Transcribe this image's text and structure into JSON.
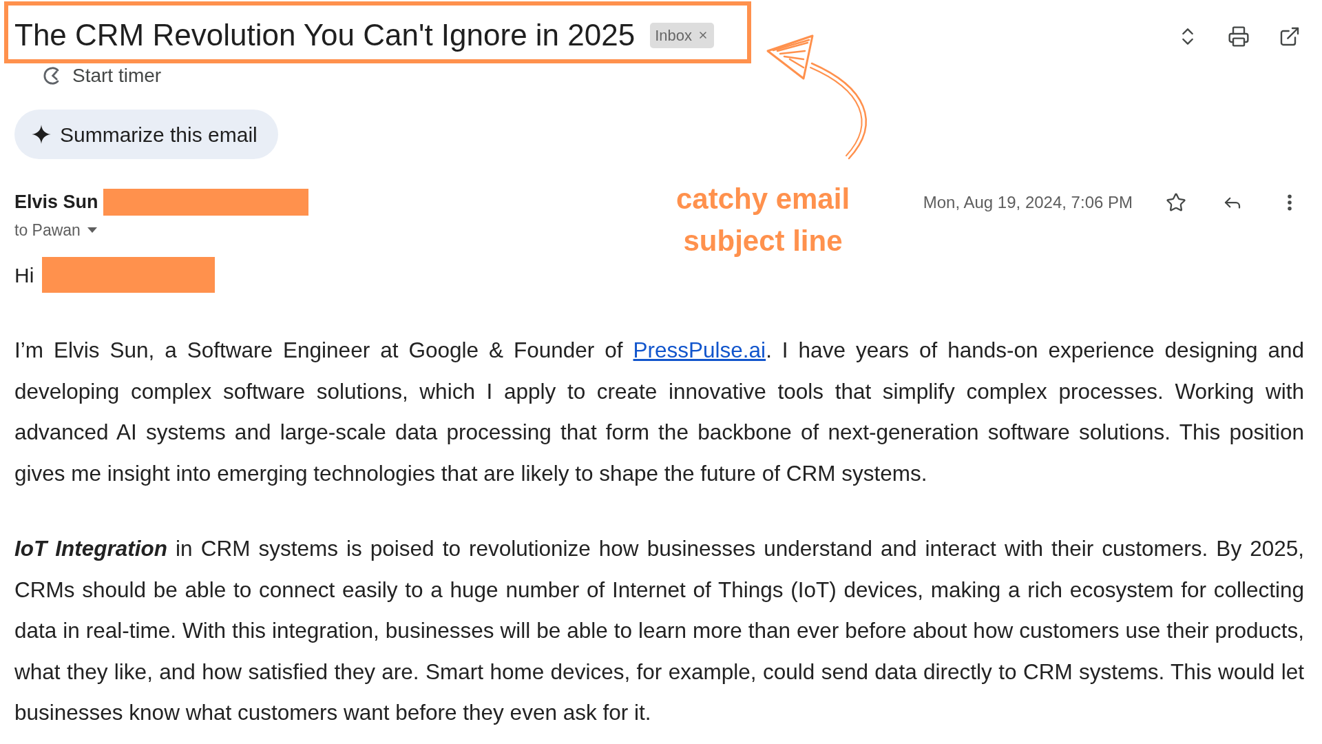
{
  "subject": {
    "title": "The CRM Revolution You Can't Ignore in 2025",
    "labels": [
      {
        "text": "Inbox"
      }
    ]
  },
  "timer": {
    "label": "Start timer"
  },
  "summarize": {
    "label": "Summarize this email"
  },
  "message": {
    "sender": "Elvis Sun",
    "recipient": "to Pawan",
    "date": "Mon, Aug 19, 2024, 7:06 PM",
    "starred": false
  },
  "greeting": "Hi",
  "body": [
    {
      "parts": [
        {
          "kind": "text",
          "text": "I’m Elvis Sun, a Software Engineer at Google & Founder of "
        },
        {
          "kind": "link",
          "text": "PressPulse.ai"
        },
        {
          "kind": "text",
          "text": ". I have years of hands-on experience designing and developing complex software solutions, which I apply to create innovative tools that simplify complex processes. Working with advanced AI systems and large-scale data processing that form the backbone of next-generation software solutions. This position gives me insight into emerging technologies that are likely to shape the future of CRM systems."
        }
      ]
    },
    {
      "parts": [
        {
          "kind": "emphasis",
          "text": "IoT Integration"
        },
        {
          "kind": "text",
          "text": " in CRM systems is poised to revolutionize how businesses understand and interact with their customers. By 2025, CRMs should be able to connect easily to a huge number of Internet of Things (IoT) devices, making a rich ecosystem for collecting data in real-time. With this integration, businesses will be able to learn more than ever before about how customers use their products, what they like, and how satisfied they are. Smart home devices, for example, could send data directly to CRM systems. This would let businesses know what customers want before they even ask for it."
        }
      ]
    }
  ],
  "annotation": {
    "text": "catchy email subject line"
  }
}
